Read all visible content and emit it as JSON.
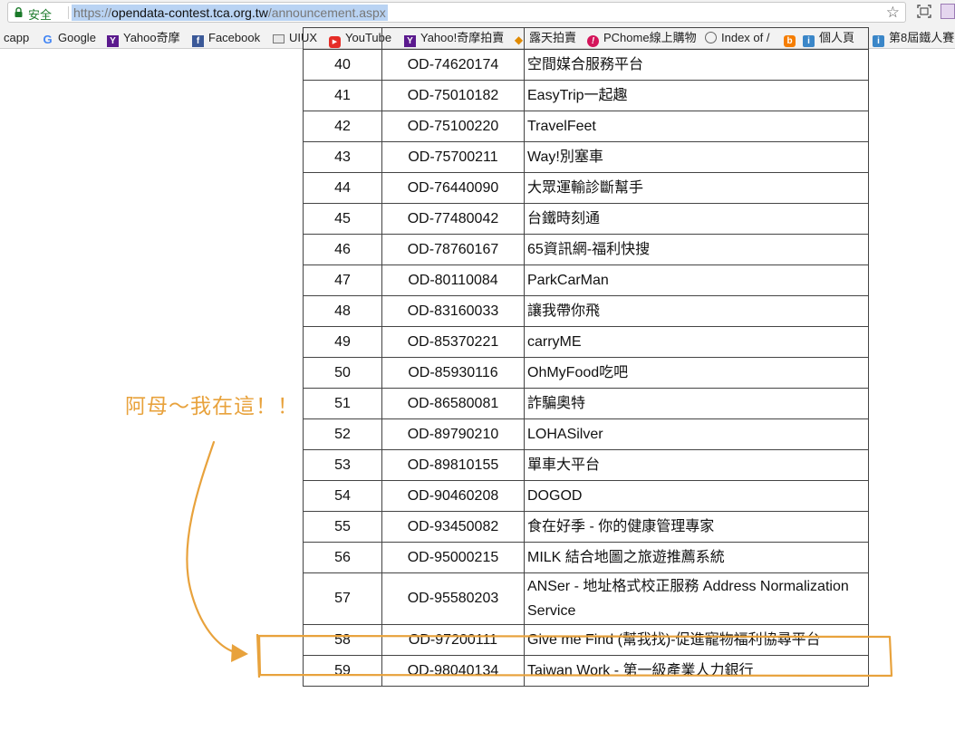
{
  "browser": {
    "secure_label": "安全",
    "url_scheme": "https://",
    "url_host": "opendata-contest.tca.org.tw",
    "url_path": "/announcement.aspx",
    "bookmarks": [
      {
        "label": "capp",
        "icon": ""
      },
      {
        "label": "Google",
        "icon": "google-icon"
      },
      {
        "label": "Yahoo奇摩",
        "icon": "yahoo-icon"
      },
      {
        "label": "Facebook",
        "icon": "facebook-icon"
      },
      {
        "label": "UIUX",
        "icon": "folder-icon"
      },
      {
        "label": "YouTube",
        "icon": "youtube-icon"
      },
      {
        "label": "Yahoo!奇摩拍賣",
        "icon": "yahoo-icon"
      },
      {
        "label": "露天拍賣",
        "icon": "ruten-icon"
      },
      {
        "label": "PChome線上購物",
        "icon": "pchome-icon"
      },
      {
        "label": "Index of /",
        "icon": "globe-icon"
      },
      {
        "label": "個人頁",
        "icon": "blogger-icon"
      },
      {
        "label": "第8屆鐵人賽",
        "icon": "ithome-icon"
      }
    ]
  },
  "table": {
    "rows": [
      {
        "no": "",
        "id": "",
        "name": ""
      },
      {
        "no": "40",
        "id": "OD-74620174",
        "name": "空間媒合服務平台"
      },
      {
        "no": "41",
        "id": "OD-75010182",
        "name": "EasyTrip一起趣"
      },
      {
        "no": "42",
        "id": "OD-75100220",
        "name": "TravelFeet"
      },
      {
        "no": "43",
        "id": "OD-75700211",
        "name": "Way!別塞車"
      },
      {
        "no": "44",
        "id": "OD-76440090",
        "name": "大眾運輸診斷幫手"
      },
      {
        "no": "45",
        "id": "OD-77480042",
        "name": "台鐵時刻通"
      },
      {
        "no": "46",
        "id": "OD-78760167",
        "name": "65資訊網-福利快搜"
      },
      {
        "no": "47",
        "id": "OD-80110084",
        "name": "ParkCarMan"
      },
      {
        "no": "48",
        "id": "OD-83160033",
        "name": "讓我帶你飛"
      },
      {
        "no": "49",
        "id": "OD-85370221",
        "name": "carryME"
      },
      {
        "no": "50",
        "id": "OD-85930116",
        "name": "OhMyFood吃吧"
      },
      {
        "no": "51",
        "id": "OD-86580081",
        "name": "詐騙奧特"
      },
      {
        "no": "52",
        "id": "OD-89790210",
        "name": "LOHASilver"
      },
      {
        "no": "53",
        "id": "OD-89810155",
        "name": "單車大平台"
      },
      {
        "no": "54",
        "id": "OD-90460208",
        "name": "DOGOD"
      },
      {
        "no": "55",
        "id": "OD-93450082",
        "name": "食在好季 - 你的健康管理專家"
      },
      {
        "no": "56",
        "id": "OD-95000215",
        "name": "MILK 結合地圖之旅遊推薦系統"
      },
      {
        "no": "57",
        "id": "OD-95580203",
        "name": "ANSer - 地址格式校正服務 Address Normalization Service"
      },
      {
        "no": "58",
        "id": "OD-97200111",
        "name": "Give me Find (幫我找)-促進寵物福利協尋平台"
      },
      {
        "no": "59",
        "id": "OD-98040134",
        "name": "Taiwan Work - 第一級產業人力銀行"
      }
    ]
  },
  "annotation": {
    "text": "阿母～我在這！！",
    "color": "#e8a23c"
  }
}
